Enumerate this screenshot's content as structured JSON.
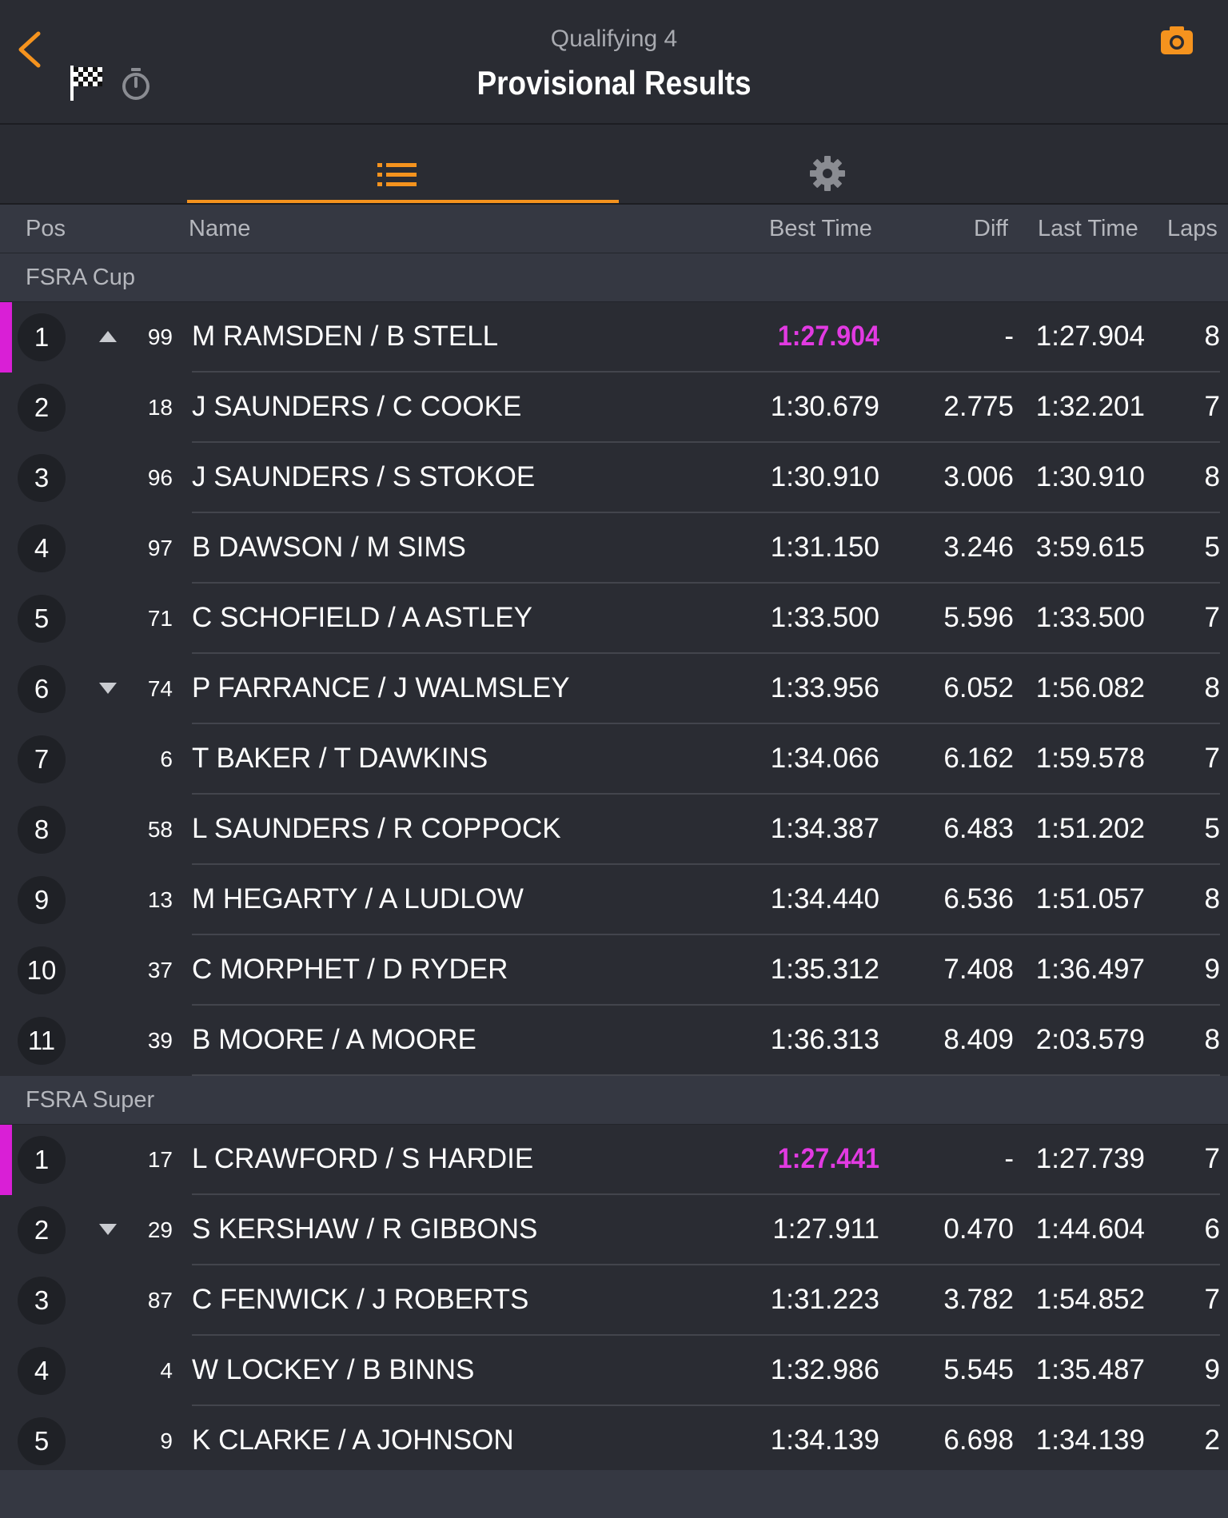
{
  "header": {
    "session": "Qualifying 4",
    "title": "Provisional Results"
  },
  "colors": {
    "accent": "#f5931e",
    "fastest": "#e23ae2",
    "background": "#2a2c33",
    "subheader": "#353842"
  },
  "icons": {
    "back": "chevron-left-icon",
    "flag": "checkered-flag-icon",
    "timer": "stopwatch-icon",
    "camera": "camera-icon",
    "results_tab": "list-icon",
    "settings_tab": "gear-icon",
    "trend_up": "triangle-up-icon",
    "trend_down": "triangle-down-icon"
  },
  "columns": {
    "pos": "Pos",
    "name": "Name",
    "best": "Best Time",
    "diff": "Diff",
    "last": "Last Time",
    "laps": "Laps"
  },
  "groups": [
    {
      "name": "FSRA Cup",
      "rows": [
        {
          "pos": "1",
          "trend": "up",
          "num": "99",
          "name": "M RAMSDEN / B STELL",
          "best": "1:27.904",
          "fastest": true,
          "diff": "-",
          "last": "1:27.904",
          "laps": "8"
        },
        {
          "pos": "2",
          "trend": "",
          "num": "18",
          "name": "J SAUNDERS / C COOKE",
          "best": "1:30.679",
          "fastest": false,
          "diff": "2.775",
          "last": "1:32.201",
          "laps": "7"
        },
        {
          "pos": "3",
          "trend": "",
          "num": "96",
          "name": "J SAUNDERS / S STOKOE",
          "best": "1:30.910",
          "fastest": false,
          "diff": "3.006",
          "last": "1:30.910",
          "laps": "8"
        },
        {
          "pos": "4",
          "trend": "",
          "num": "97",
          "name": "B DAWSON / M SIMS",
          "best": "1:31.150",
          "fastest": false,
          "diff": "3.246",
          "last": "3:59.615",
          "laps": "5"
        },
        {
          "pos": "5",
          "trend": "",
          "num": "71",
          "name": "C SCHOFIELD / A ASTLEY",
          "best": "1:33.500",
          "fastest": false,
          "diff": "5.596",
          "last": "1:33.500",
          "laps": "7"
        },
        {
          "pos": "6",
          "trend": "down",
          "num": "74",
          "name": "P FARRANCE / J WALMSLEY",
          "best": "1:33.956",
          "fastest": false,
          "diff": "6.052",
          "last": "1:56.082",
          "laps": "8"
        },
        {
          "pos": "7",
          "trend": "",
          "num": "6",
          "name": "T BAKER / T DAWKINS",
          "best": "1:34.066",
          "fastest": false,
          "diff": "6.162",
          "last": "1:59.578",
          "laps": "7"
        },
        {
          "pos": "8",
          "trend": "",
          "num": "58",
          "name": "L SAUNDERS / R COPPOCK",
          "best": "1:34.387",
          "fastest": false,
          "diff": "6.483",
          "last": "1:51.202",
          "laps": "5"
        },
        {
          "pos": "9",
          "trend": "",
          "num": "13",
          "name": "M HEGARTY / A LUDLOW",
          "best": "1:34.440",
          "fastest": false,
          "diff": "6.536",
          "last": "1:51.057",
          "laps": "8"
        },
        {
          "pos": "10",
          "trend": "",
          "num": "37",
          "name": "C MORPHET / D RYDER",
          "best": "1:35.312",
          "fastest": false,
          "diff": "7.408",
          "last": "1:36.497",
          "laps": "9"
        },
        {
          "pos": "11",
          "trend": "",
          "num": "39",
          "name": "B MOORE / A MOORE",
          "best": "1:36.313",
          "fastest": false,
          "diff": "8.409",
          "last": "2:03.579",
          "laps": "8"
        }
      ]
    },
    {
      "name": "FSRA Super",
      "rows": [
        {
          "pos": "1",
          "trend": "",
          "num": "17",
          "name": "L CRAWFORD / S HARDIE",
          "best": "1:27.441",
          "fastest": true,
          "diff": "-",
          "last": "1:27.739",
          "laps": "7"
        },
        {
          "pos": "2",
          "trend": "down",
          "num": "29",
          "name": "S KERSHAW / R GIBBONS",
          "best": "1:27.911",
          "fastest": false,
          "diff": "0.470",
          "last": "1:44.604",
          "laps": "6"
        },
        {
          "pos": "3",
          "trend": "",
          "num": "87",
          "name": "C FENWICK / J ROBERTS",
          "best": "1:31.223",
          "fastest": false,
          "diff": "3.782",
          "last": "1:54.852",
          "laps": "7"
        },
        {
          "pos": "4",
          "trend": "",
          "num": "4",
          "name": "W LOCKEY / B BINNS",
          "best": "1:32.986",
          "fastest": false,
          "diff": "5.545",
          "last": "1:35.487",
          "laps": "9"
        },
        {
          "pos": "5",
          "trend": "",
          "num": "9",
          "name": "K CLARKE / A JOHNSON",
          "best": "1:34.139",
          "fastest": false,
          "diff": "6.698",
          "last": "1:34.139",
          "laps": "2"
        }
      ]
    }
  ]
}
